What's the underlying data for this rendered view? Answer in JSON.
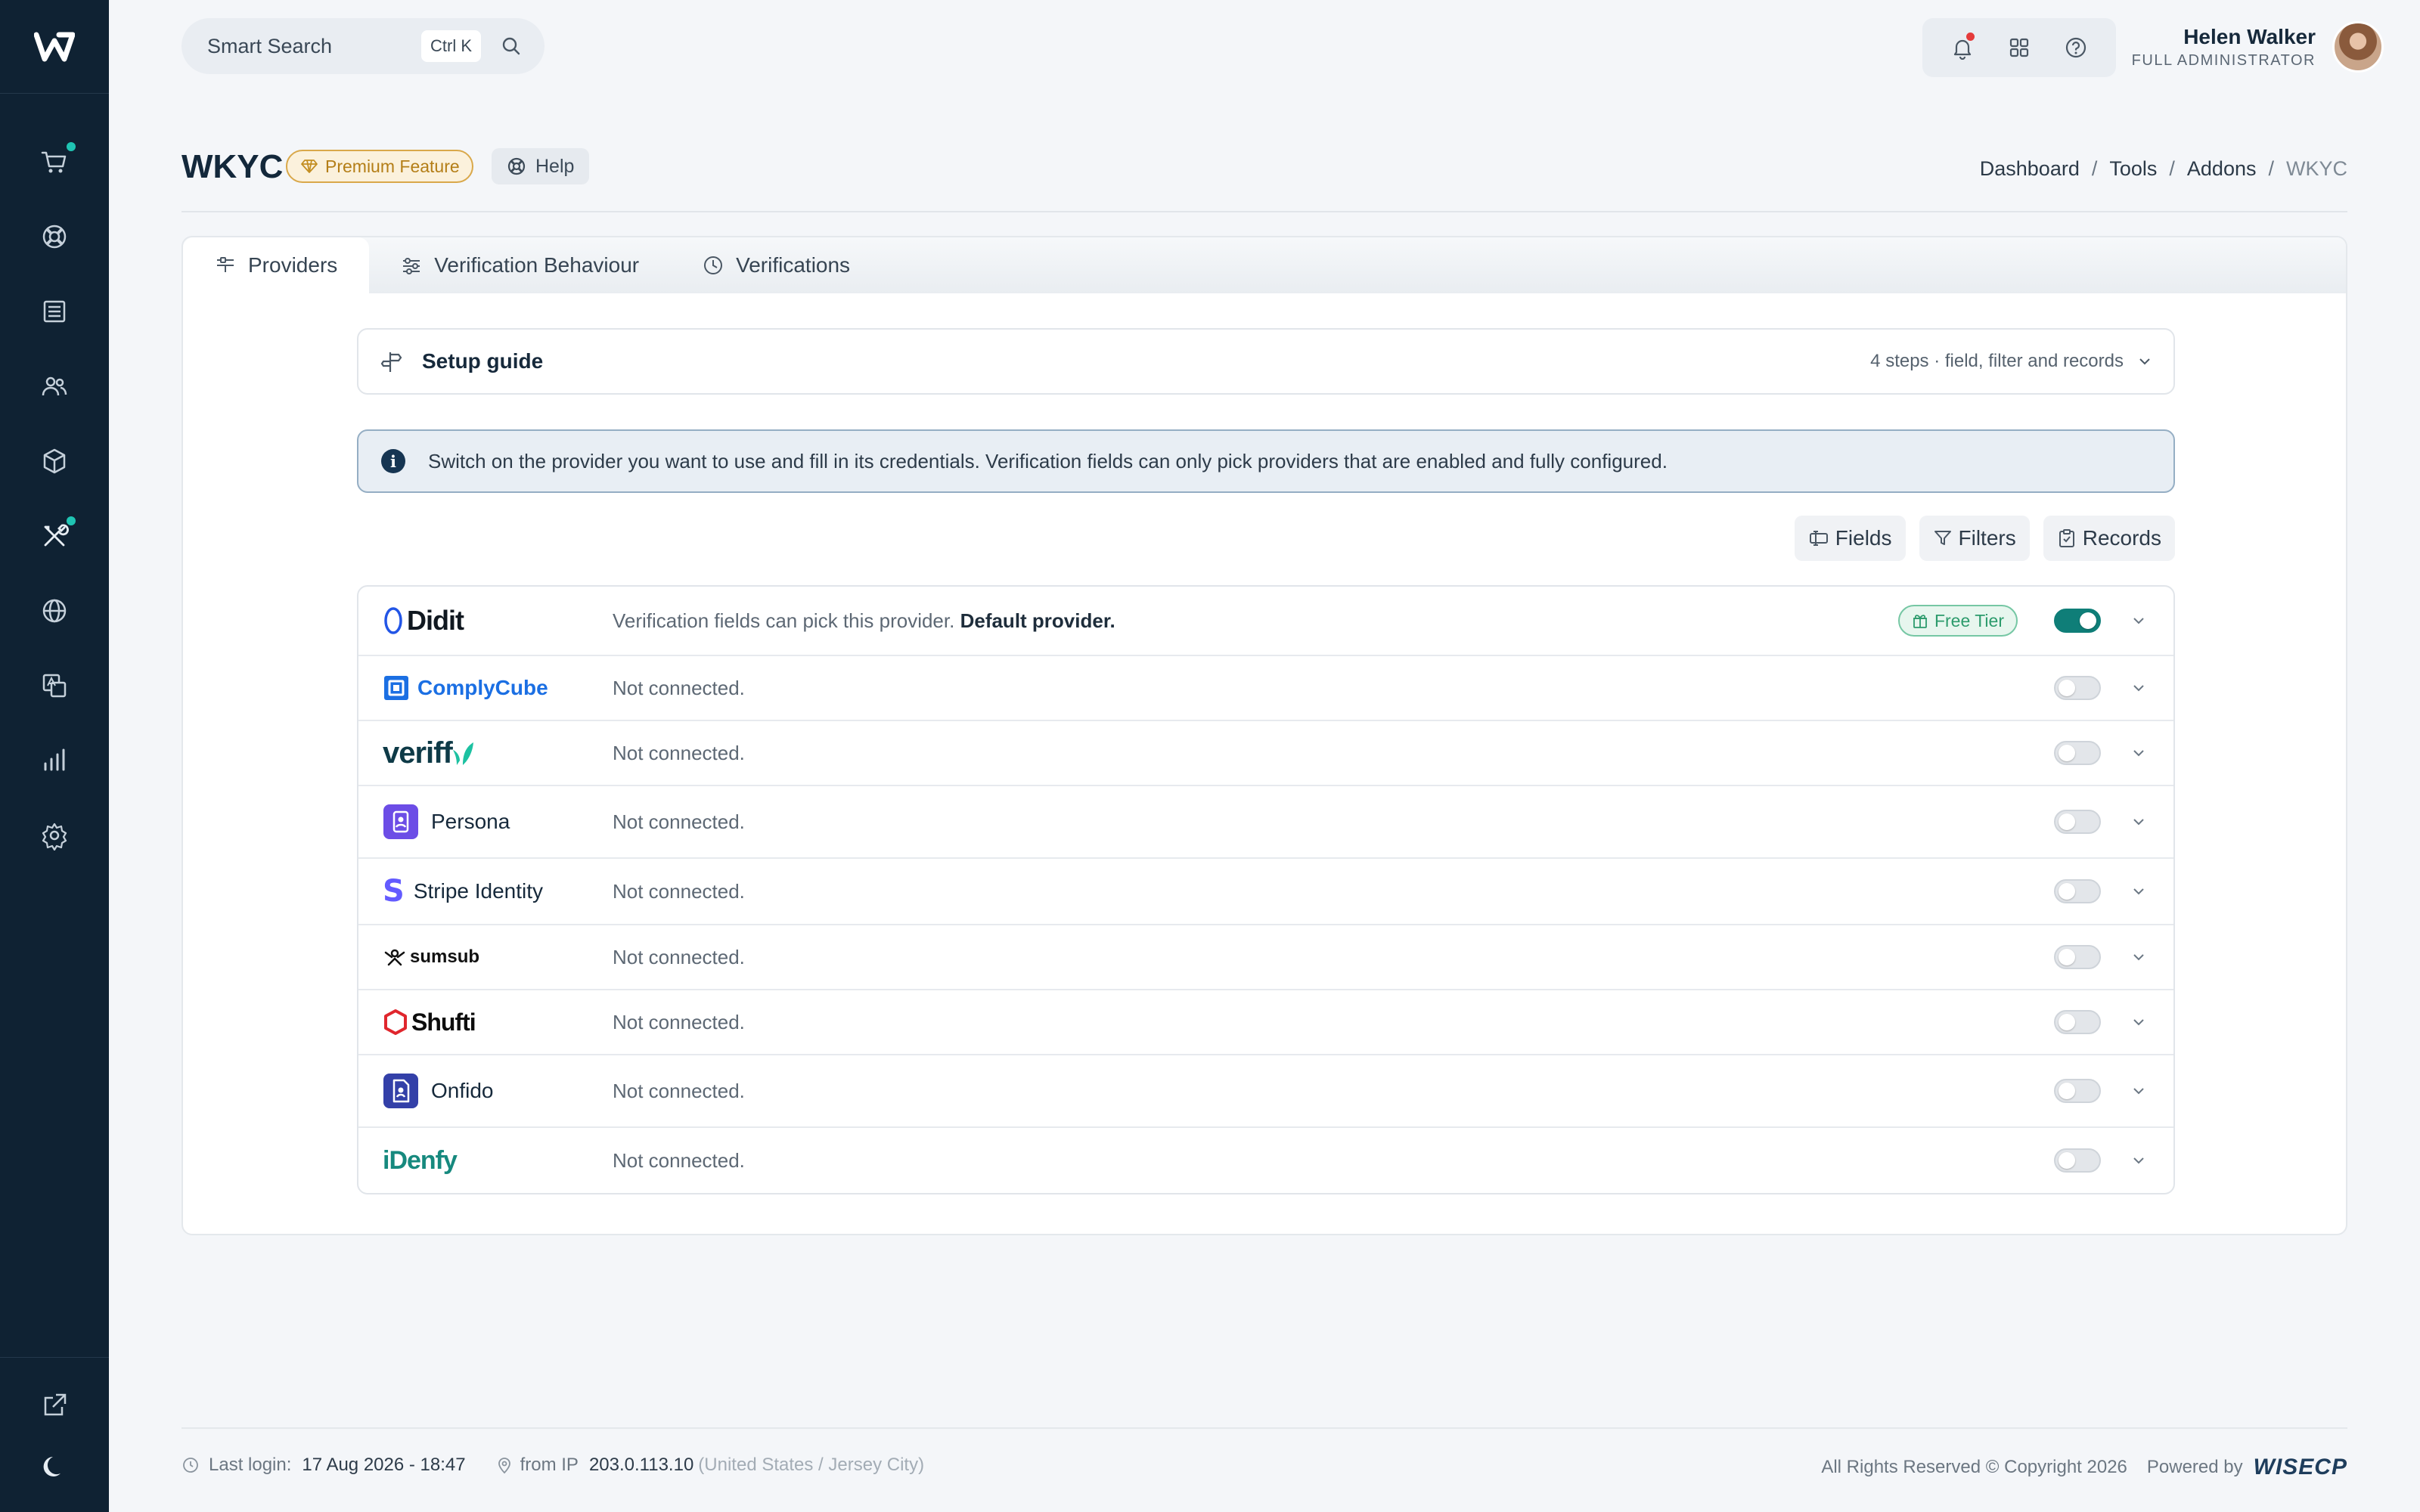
{
  "sidebar": {
    "logo": "W",
    "items": [
      {
        "icon": "cart-icon",
        "dot": true
      },
      {
        "icon": "support-icon",
        "dot": false
      },
      {
        "icon": "invoice-icon",
        "dot": false
      },
      {
        "icon": "users-icon",
        "dot": false
      },
      {
        "icon": "box-icon",
        "dot": false
      },
      {
        "icon": "tools-icon",
        "dot": true
      },
      {
        "icon": "globe-icon",
        "dot": false
      },
      {
        "icon": "translate-icon",
        "dot": false
      },
      {
        "icon": "stats-icon",
        "dot": false
      },
      {
        "icon": "gear-icon",
        "dot": false
      }
    ],
    "bottom": [
      {
        "icon": "external-link-icon"
      },
      {
        "icon": "moon-icon"
      }
    ]
  },
  "topbar": {
    "search_placeholder": "Smart Search",
    "shortcut": "Ctrl K",
    "user_name": "Helen Walker",
    "user_role": "FULL ADMINISTRATOR"
  },
  "header": {
    "title": "WKYC",
    "badge": "Premium Feature",
    "help": "Help",
    "breadcrumb": [
      "Dashboard",
      "Tools",
      "Addons",
      "WKYC"
    ]
  },
  "tabs": [
    "Providers",
    "Verification Behaviour",
    "Verifications"
  ],
  "setup": {
    "title": "Setup guide",
    "meta": "4 steps · field, filter and records"
  },
  "info": "Switch on the provider you want to use and fill in its credentials. Verification fields can only pick providers that are enabled and fully configured.",
  "actions": [
    "Fields",
    "Filters",
    "Records"
  ],
  "providers": [
    {
      "name": "Didit",
      "status": "Verification fields can pick this provider.",
      "status_bold": "Default provider.",
      "badge": "Free Tier",
      "enabled": true
    },
    {
      "name": "ComplyCube",
      "status": "Not connected.",
      "enabled": false
    },
    {
      "name": "veriff",
      "status": "Not connected.",
      "enabled": false
    },
    {
      "name": "Persona",
      "status": "Not connected.",
      "enabled": false
    },
    {
      "name": "Stripe Identity",
      "status": "Not connected.",
      "enabled": false
    },
    {
      "name": "sumsub",
      "status": "Not connected.",
      "enabled": false
    },
    {
      "name": "Shufti",
      "status": "Not connected.",
      "enabled": false
    },
    {
      "name": "Onfido",
      "status": "Not connected.",
      "enabled": false
    },
    {
      "name": "iDenfy",
      "status": "Not connected.",
      "enabled": false
    }
  ],
  "footer": {
    "last_login_label": "Last login:",
    "last_login": "17 Aug 2026 - 18:47",
    "ip_label": "from IP",
    "ip": "203.0.113.10",
    "location": "(United States / Jersey City)",
    "copyright": "All Rights Reserved © Copyright 2026",
    "powered": "Powered by",
    "brand": "WISECP"
  },
  "colors": {
    "sidebar": "#0f2233",
    "accent": "#0f7e78",
    "premium": "#d9a84a",
    "notification": "#e53b3b",
    "nav_dot": "#1fc4b3"
  }
}
